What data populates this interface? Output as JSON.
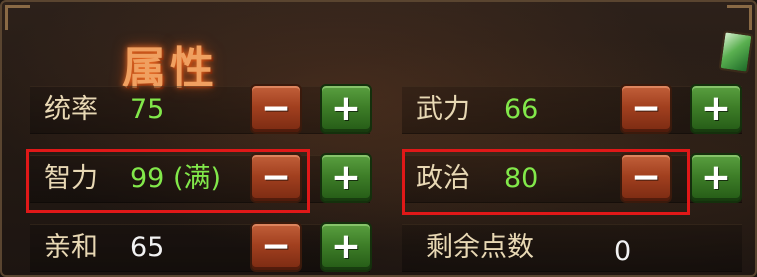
{
  "panel": {
    "title": "属性",
    "highlight_color": "#e01818"
  },
  "attributes": [
    {
      "label": "统率",
      "value": "75",
      "value_color": "#82e84a"
    },
    {
      "label": "武力",
      "value": "66",
      "value_color": "#82e84a"
    },
    {
      "label": "智力",
      "value": "99 (满)",
      "value_color": "#82e84a"
    },
    {
      "label": "政治",
      "value": "80",
      "value_color": "#82e84a"
    },
    {
      "label": "亲和",
      "value": "65",
      "value_color": "#f2f2f2"
    }
  ],
  "remaining_points": {
    "label": "剩余点数",
    "value": "0"
  },
  "buttons": {
    "minus_glyph": "−",
    "plus_glyph": "+",
    "minus_color": "#a2401f",
    "plus_color": "#3e7e28"
  },
  "icons": {
    "gem": "green-gem-icon"
  }
}
